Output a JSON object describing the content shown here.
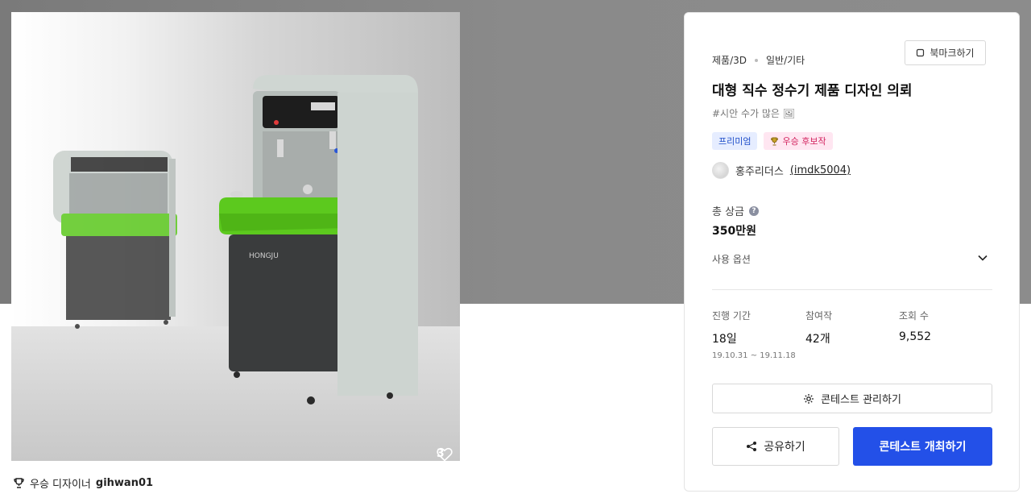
{
  "product": {
    "like_count": "3",
    "winner_prefix": "우승 디자이너",
    "winner_name": "gihwan01"
  },
  "contest": {
    "category": "제품/3D",
    "subcategory": "일반/기타",
    "bookmark_label": "북마크하기",
    "title": "대형 직수 정수기 제품 디자인 의뢰",
    "hashtags": "#시안 수가 많은 🖼",
    "badges": {
      "premium": "프리미엄",
      "best": "우승 후보작"
    },
    "host_name": "홍주리더스",
    "host_id": "(imdk5004)",
    "prize_label": "총 상금",
    "prize_value": "350만원",
    "usage_label": "사용 옵션",
    "stats": {
      "period_label": "진행 기간",
      "period_value": "18일",
      "period_range": "19.10.31 ~ 19.11.18",
      "entries_label": "참여작",
      "entries_value": "42개",
      "views_label": "조회 수",
      "views_value": "9,552"
    },
    "manage_label": "콘테스트 관리하기",
    "share_label": "공유하기",
    "host_button_label": "콘테스트 개최하기"
  },
  "colors": {
    "accent": "#2350e8",
    "premium_bg": "#e6edff",
    "best_bg": "#ffe6f1",
    "dispenser_green": "#5cc91e"
  }
}
